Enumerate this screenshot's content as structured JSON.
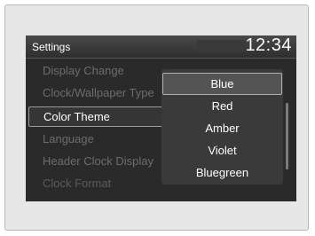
{
  "header": {
    "title": "Settings",
    "clock": "12:34"
  },
  "menu": {
    "items": [
      {
        "label": "Display Change"
      },
      {
        "label": "Clock/Wallpaper Type"
      },
      {
        "label": "Color Theme"
      },
      {
        "label": "Language"
      },
      {
        "label": "Header Clock Display"
      },
      {
        "label": "Clock Format"
      }
    ]
  },
  "dropdown": {
    "options": [
      {
        "label": "Blue",
        "selected": true
      },
      {
        "label": "Red"
      },
      {
        "label": "Amber"
      },
      {
        "label": "Violet"
      },
      {
        "label": "Bluegreen"
      }
    ]
  },
  "colors": {
    "screen_bg": "#2a2a2a",
    "dim_text": "#6c6c6c",
    "active_text": "#ffffff"
  }
}
